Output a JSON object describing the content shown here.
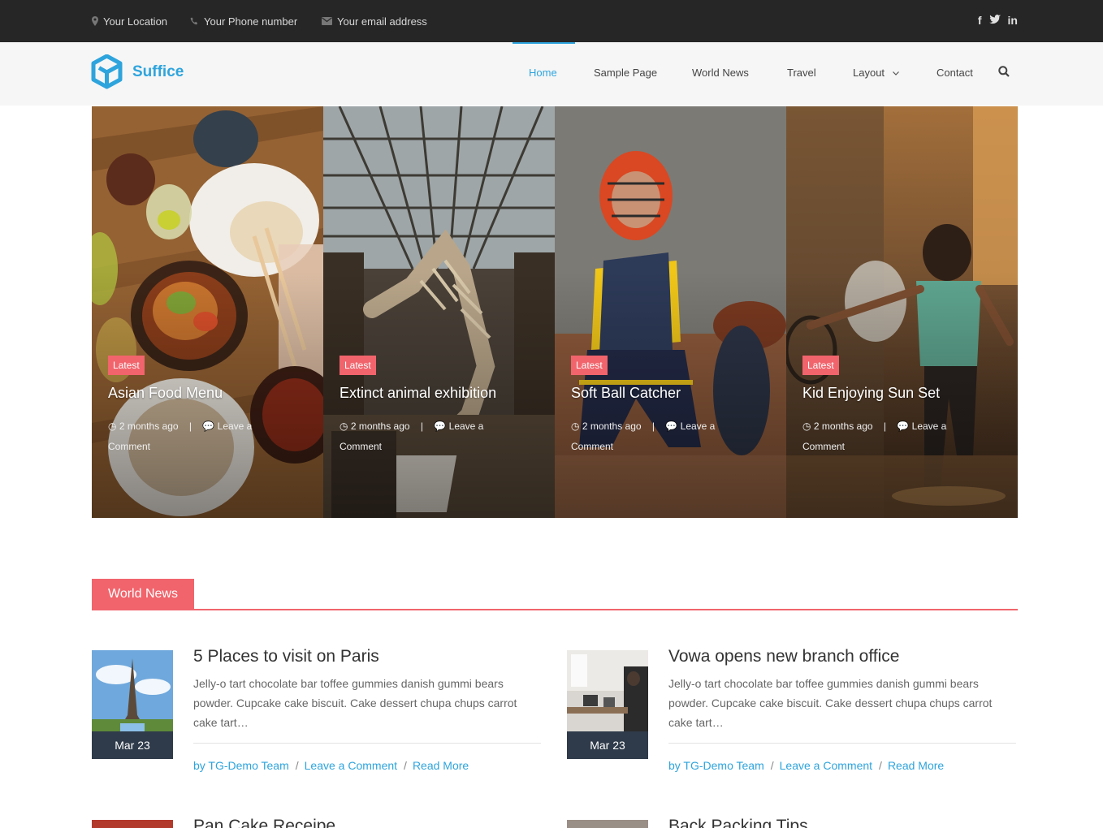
{
  "topbar": {
    "location": "Your Location",
    "phone": "Your Phone number",
    "email": "Your email address"
  },
  "brand": {
    "name": "Suffice",
    "accent": "#2ea4dd"
  },
  "nav": {
    "items": [
      "Home",
      "Sample Page",
      "World News",
      "Travel",
      "Layout",
      "Contact"
    ],
    "active": "Home"
  },
  "slides": [
    {
      "badge": "Latest",
      "title": "Asian Food Menu",
      "time": "2 months ago",
      "comment": "Leave a Comment"
    },
    {
      "badge": "Latest",
      "title": "Extinct animal exhibition",
      "time": "2 months ago",
      "comment": "Leave a Comment"
    },
    {
      "badge": "Latest",
      "title": "Soft Ball Catcher",
      "time": "2 months ago",
      "comment": "Leave a Comment"
    },
    {
      "badge": "Latest",
      "title": "Kid Enjoying Sun Set",
      "time": "2 months ago",
      "comment": "Leave a Comment"
    }
  ],
  "section": {
    "title": "World News",
    "color": "#f1646c"
  },
  "posts": [
    {
      "title": "5 Places to visit on Paris",
      "excerpt": "Jelly-o tart chocolate bar toffee gummies danish gummi bears powder. Cupcake cake biscuit. Cake dessert chupa chups carrot cake tart…",
      "date": "Mar 23",
      "author": "by TG-Demo Team",
      "comment": "Leave a Comment",
      "more": "Read More"
    },
    {
      "title": "Vowa opens new branch office",
      "excerpt": "Jelly-o tart chocolate bar toffee gummies danish gummi bears powder. Cupcake cake biscuit. Cake dessert chupa chups carrot cake tart…",
      "date": "Mar 23",
      "author": "by TG-Demo Team",
      "comment": "Leave a Comment",
      "more": "Read More"
    },
    {
      "title": "Pan Cake Receipe"
    },
    {
      "title": "Back Packing Tips"
    }
  ]
}
